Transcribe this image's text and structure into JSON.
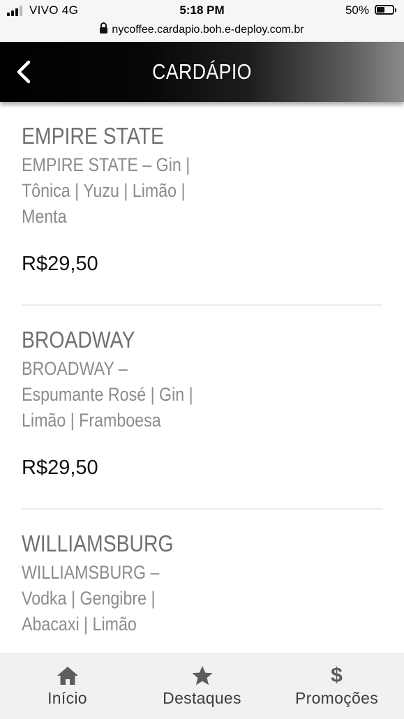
{
  "status_bar": {
    "carrier": "VIVO  4G",
    "time": "5:18 PM",
    "battery": "50%"
  },
  "url_bar": {
    "url": "nycoffee.cardapio.boh.e-deploy.com.br"
  },
  "header": {
    "title": "CARDÁPIO",
    "back_icon": "chevron-left-icon"
  },
  "menu_items": [
    {
      "name": "EMPIRE STATE",
      "description": "EMPIRE STATE – Gin | Tônica | Yuzu | Limão | Menta",
      "price": "R$29,50"
    },
    {
      "name": "BROADWAY",
      "description": "BROADWAY – Espumante Rosé | Gin | Limão | Framboesa",
      "price": "R$29,50"
    },
    {
      "name": "WILLIAMSBURG",
      "description": "WILLIAMSBURG – Vodka | Gengibre | Abacaxi | Limão",
      "price": ""
    }
  ],
  "tab_bar": {
    "tabs": [
      {
        "label": "Início",
        "icon": "home-icon"
      },
      {
        "label": "Destaques",
        "icon": "star-icon"
      },
      {
        "label": "Promoções",
        "icon": "dollar-icon",
        "glyph": "$"
      }
    ]
  },
  "colors": {
    "header_background": "#000000",
    "item_name": "#707070",
    "item_description": "#8b8b8b",
    "price": "#111111",
    "tab_bar_background": "#f1f1f1"
  }
}
